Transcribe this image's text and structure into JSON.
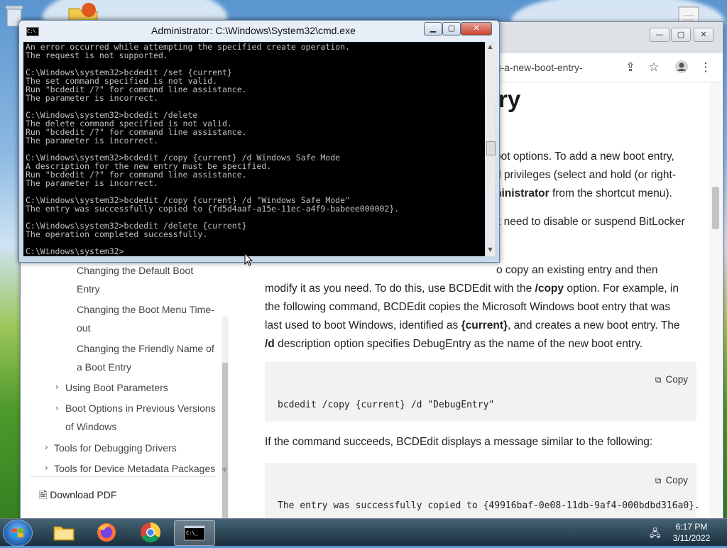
{
  "browser": {
    "url_fragment": "ding-a-new-boot-entry-",
    "page_title": "try",
    "nav_items": [
      {
        "label": "Changing the Default Boot Entry",
        "line1": "Changing the Default Boot",
        "line2": "Entry"
      },
      {
        "label": "Changing the Boot Menu Time-out",
        "line1": "Changing the Boot Menu Time-",
        "line2": "out"
      },
      {
        "label": "Changing the Friendly Name of a Boot Entry",
        "line1": "Changing the Friendly Name of",
        "line2": "a Boot Entry"
      },
      {
        "label": "Using Boot Parameters"
      },
      {
        "label": "Boot Options in Previous Versions of Windows",
        "line1": "Boot Options in Previous Versions",
        "line2": "of Windows"
      },
      {
        "label": "Tools for Debugging Drivers"
      },
      {
        "label": "Tools for Device Metadata Packages"
      }
    ],
    "download_pdf": "Download PDF",
    "content": {
      "p1_l1": "oot options. To add a new boot entry,",
      "p1_l2": "d privileges (select and hold (or right-",
      "p1_l3_bold": "ninistrator",
      "p1_l3_rest": " from the shortcut menu).",
      "p2_l1": "t need to disable or suspend BitLocker",
      "p3_l1": "o copy an existing entry and then",
      "p3_l2_a": "modify it as you need. To do this, use BCDEdit with the ",
      "p3_l2_bold": "/copy",
      "p3_l2_b": " option. For example, in",
      "p3_l3": "the following command, BCDEdit copies the Microsoft Windows boot entry that was",
      "p3_l4_a": "last used to boot Windows, identified as ",
      "p3_l4_bold": "{current}",
      "p3_l4_b": ", and creates a new boot entry. The",
      "p3_l5_bold": "/d",
      "p3_l5_rest": " description option specifies DebugEntry as the name of the new boot entry.",
      "copy_label": "Copy",
      "code1": "bcdedit /copy {current} /d \"DebugEntry\"",
      "p4": "If the command succeeds, BCDEdit displays a message similar to the following:",
      "code2": "The entry was successfully copied to {49916baf-0e08-11db-9af4-000bdbd316a0}."
    }
  },
  "cmd": {
    "title": "Administrator: C:\\Windows\\System32\\cmd.exe",
    "lines": [
      "An error occurred while attempting the specified create operation.",
      "The request is not supported.",
      "",
      "C:\\Windows\\system32>bcdedit /set {current}",
      "The set command specified is not valid.",
      "Run \"bcdedit /?\" for command line assistance.",
      "The parameter is incorrect.",
      "",
      "C:\\Windows\\system32>bcdedit /delete",
      "The delete command specified is not valid.",
      "Run \"bcdedit /?\" for command line assistance.",
      "The parameter is incorrect.",
      "",
      "C:\\Windows\\system32>bcdedit /copy {current} /d Windows Safe Mode",
      "A description for the new entry must be specified.",
      "Run \"bcdedit /?\" for command line assistance.",
      "The parameter is incorrect.",
      "",
      "C:\\Windows\\system32>bcdedit /copy {current} /d \"Windows Safe Mode\"",
      "The entry was successfully copied to {fd5d4aaf-a15e-11ec-a4f9-babeee000002}.",
      "",
      "C:\\Windows\\system32>bcdedit /delete {current}",
      "The operation completed successfully.",
      "",
      "C:\\Windows\\system32>"
    ]
  },
  "taskbar": {
    "apps": [
      "file-explorer",
      "firefox",
      "chrome",
      "command-prompt"
    ],
    "time": "6:17 PM",
    "date": "3/11/2022"
  },
  "colors": {
    "cmd_text": "#c0c0c0",
    "cmd_bg": "#000000",
    "code_bg": "#f2f2f2"
  }
}
